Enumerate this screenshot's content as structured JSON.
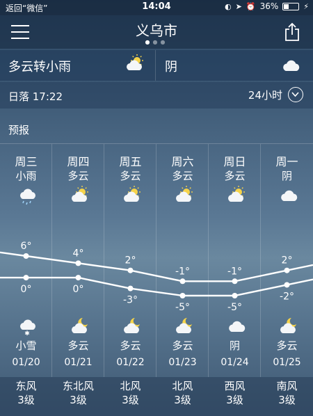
{
  "status_bar": {
    "back_label": "返回“微信”",
    "time": "14:04",
    "battery_text": "36%",
    "battery_level": 0.36
  },
  "header": {
    "city": "义乌市",
    "page_dots": [
      "active",
      "inactive",
      "inactive"
    ]
  },
  "today": {
    "day_weather": "多云转小雨",
    "day_icon": "partly-cloudy-icon",
    "night_weather": "阴",
    "night_icon": "cloudy-icon"
  },
  "sun": {
    "sunset_text": "日落  17:22",
    "hours_toggle": "24小时"
  },
  "forecast": {
    "title": "预报",
    "days": [
      {
        "weekday": "周三",
        "day_weather": "小雨",
        "day_icon": "light-rain-icon",
        "high": "6°",
        "low": "0°",
        "night_icon": "light-snow-icon",
        "night_weather": "小雪",
        "date": "01/20",
        "wind_dir": "东风",
        "wind_level": "3级"
      },
      {
        "weekday": "周四",
        "day_weather": "多云",
        "day_icon": "partly-cloudy-icon",
        "high": "4°",
        "low": "0°",
        "night_icon": "partly-cloudy-night-icon",
        "night_weather": "多云",
        "date": "01/21",
        "wind_dir": "东北风",
        "wind_level": "3级"
      },
      {
        "weekday": "周五",
        "day_weather": "多云",
        "day_icon": "partly-cloudy-icon",
        "high": "2°",
        "low": "-3°",
        "night_icon": "partly-cloudy-night-icon",
        "night_weather": "多云",
        "date": "01/22",
        "wind_dir": "北风",
        "wind_level": "3级"
      },
      {
        "weekday": "周六",
        "day_weather": "多云",
        "day_icon": "partly-cloudy-icon",
        "high": "-1°",
        "low": "-5°",
        "night_icon": "partly-cloudy-night-icon",
        "night_weather": "多云",
        "date": "01/23",
        "wind_dir": "北风",
        "wind_level": "3级"
      },
      {
        "weekday": "周日",
        "day_weather": "多云",
        "day_icon": "partly-cloudy-icon",
        "high": "-1°",
        "low": "-5°",
        "night_icon": "cloudy-icon",
        "night_weather": "阴",
        "date": "01/24",
        "wind_dir": "西风",
        "wind_level": "3级"
      },
      {
        "weekday": "周一",
        "day_weather": "阴",
        "day_icon": "cloudy-icon",
        "high": "2°",
        "low": "-2°",
        "night_icon": "partly-cloudy-night-icon",
        "night_weather": "多云",
        "date": "01/25",
        "wind_dir": "南风",
        "wind_level": "3级"
      }
    ]
  },
  "chart_data": {
    "type": "line",
    "categories": [
      "01/20",
      "01/21",
      "01/22",
      "01/23",
      "01/24",
      "01/25"
    ],
    "series": [
      {
        "values": [
          6,
          4,
          2,
          -1,
          -1,
          2
        ]
      },
      {
        "values": [
          0,
          0,
          -3,
          -5,
          -5,
          -2
        ]
      }
    ],
    "ylim": [
      -5,
      6
    ],
    "grid": false
  }
}
